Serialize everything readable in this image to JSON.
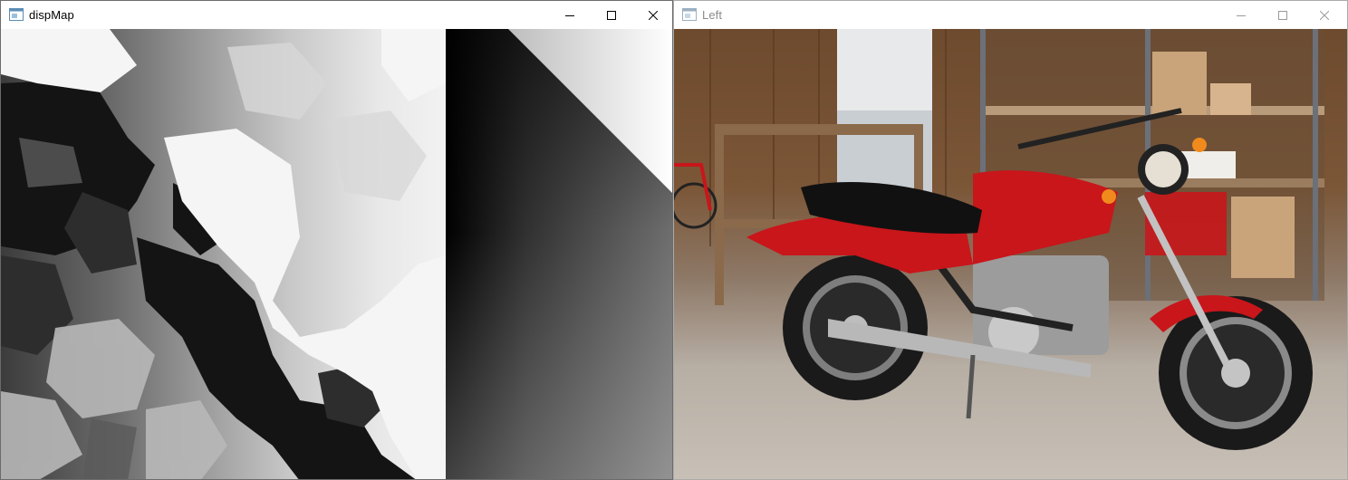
{
  "windows": [
    {
      "title": "dispMap"
    },
    {
      "title": "Left"
    }
  ],
  "controls": {
    "minimize": "minimize-icon",
    "maximize": "maximize-icon",
    "close": "close-icon"
  },
  "colors": {
    "titlebar_bg": "#ffffff",
    "active_title": "#000000",
    "inactive_title": "#8c8c8c",
    "motorcycle_red": "#c8161b"
  }
}
